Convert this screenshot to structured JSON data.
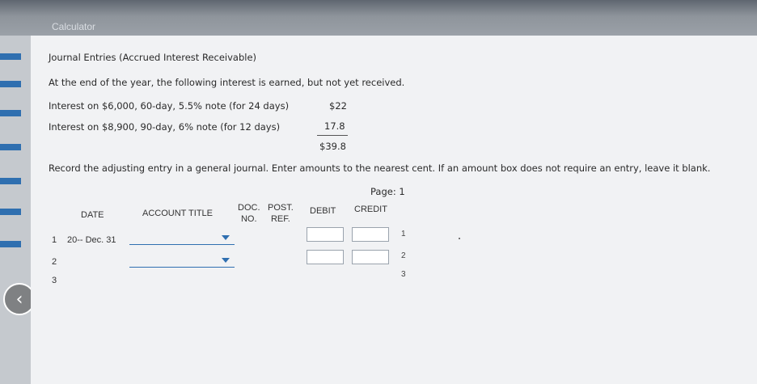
{
  "window": {
    "calculator_label": "Calculator"
  },
  "problem": {
    "title": "Journal Entries (Accrued Interest Receivable)",
    "intro": "At the end of the year, the following interest is earned, but not yet received.",
    "lines": [
      {
        "text": "Interest on $6,000, 60-day, 5.5% note (for 24 days)",
        "amount": "$22"
      },
      {
        "text": "Interest on $8,900, 90-day, 6% note (for 12 days)",
        "amount": "17.8"
      }
    ],
    "total": "$39.8",
    "instructions": "Record the adjusting entry in a general journal. Enter amounts to the nearest cent. If an amount box does not require an entry, leave it blank."
  },
  "journal": {
    "page_label": "Page: 1",
    "headers": {
      "date": "DATE",
      "account_title": "ACCOUNT TITLE",
      "doc_line1": "DOC.",
      "doc_line2": "NO.",
      "post_line1": "POST.",
      "post_line2": "REF.",
      "debit": "DEBIT",
      "credit": "CREDIT"
    },
    "rows": [
      {
        "num": "1",
        "date": "20-- Dec. 31",
        "line": "1"
      },
      {
        "num": "2",
        "date": "",
        "line": "2"
      },
      {
        "num": "3",
        "date": "",
        "line": "3"
      }
    ]
  },
  "colors": {
    "accent": "#2f6fb0",
    "panel": "#f1f2f4"
  },
  "icons": {
    "back": "chevron-left-icon",
    "dropdown": "caret-down-icon"
  }
}
